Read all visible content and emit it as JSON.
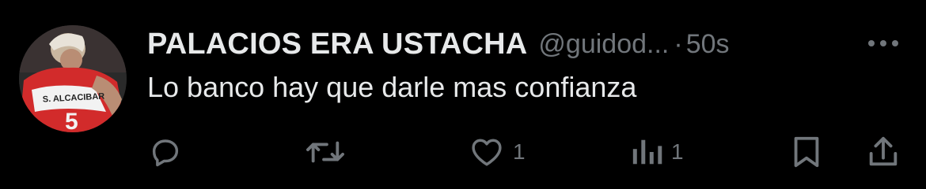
{
  "tweet": {
    "display_name": "PALACIOS ERA USTACHA",
    "handle": "@guidod...",
    "separator": "·",
    "time": "50s",
    "text": "Lo banco hay que darle mas confianza",
    "avatar_jersey_text": "S. ALCACIBAR",
    "avatar_number": "5"
  },
  "actions": {
    "reply_icon": "reply-icon",
    "retweet_icon": "retweet-icon",
    "like_icon": "heart-icon",
    "like_count": "1",
    "views_icon": "views-icon",
    "views_count": "1",
    "bookmark_icon": "bookmark-icon",
    "share_icon": "share-icon",
    "more_icon": "more-icon"
  },
  "colors": {
    "background": "#000000",
    "primary_text": "#e7e9ea",
    "secondary_text": "#71767b"
  }
}
